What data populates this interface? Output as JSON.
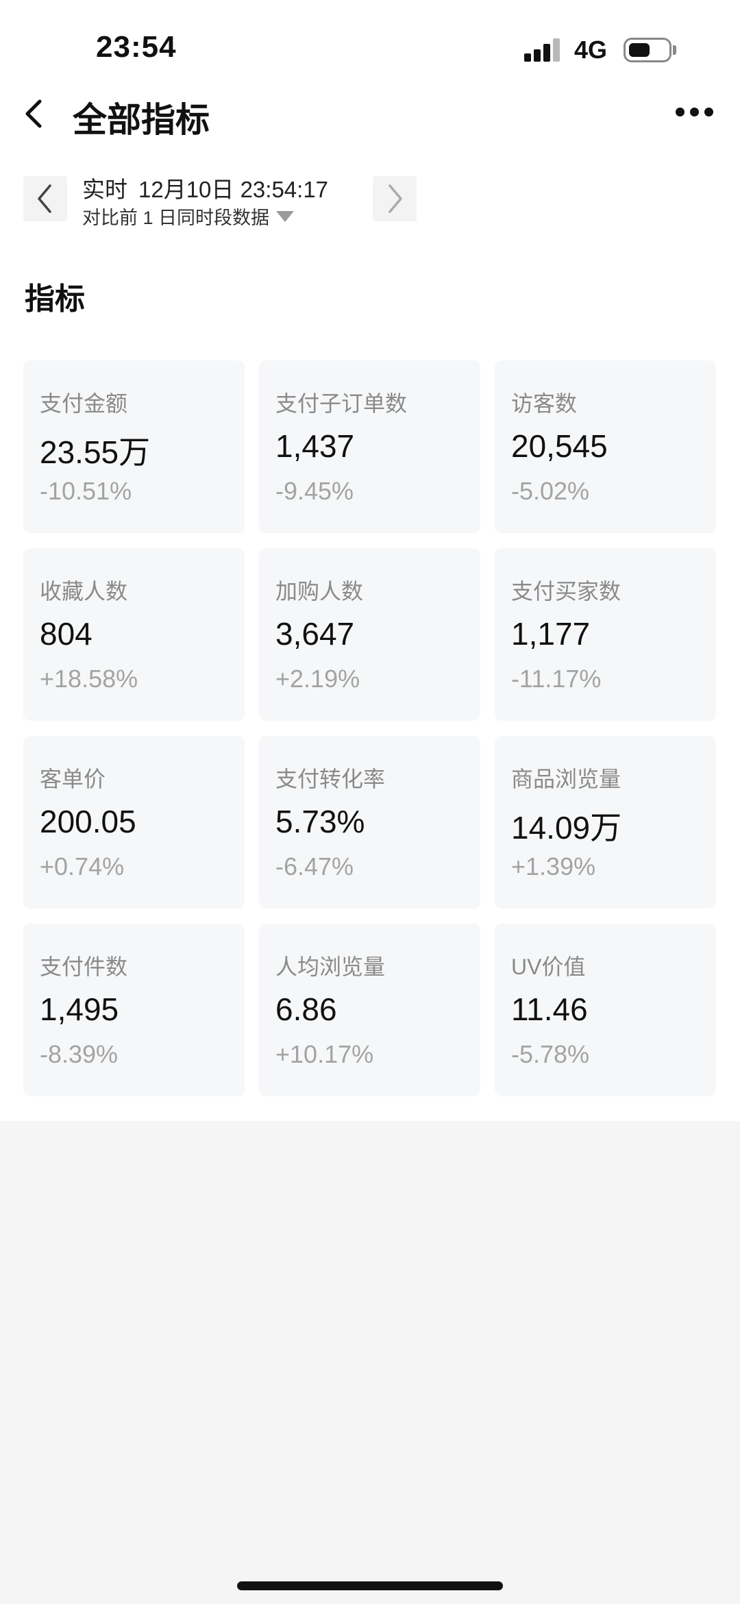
{
  "status_bar": {
    "time": "23:54",
    "network": "4G"
  },
  "header": {
    "title": "全部指标"
  },
  "date_selector": {
    "label": "实时",
    "datetime": "12月10日 23:54:17",
    "compare": "对比前 1 日同时段数据"
  },
  "section": {
    "title": "指标"
  },
  "metrics": [
    {
      "label": "支付金额",
      "value": "23.55万",
      "change": "-10.51%"
    },
    {
      "label": "支付子订单数",
      "value": "1,437",
      "change": "-9.45%"
    },
    {
      "label": "访客数",
      "value": "20,545",
      "change": "-5.02%"
    },
    {
      "label": "收藏人数",
      "value": "804",
      "change": "+18.58%"
    },
    {
      "label": "加购人数",
      "value": "3,647",
      "change": "+2.19%"
    },
    {
      "label": "支付买家数",
      "value": "1,177",
      "change": "-11.17%"
    },
    {
      "label": "客单价",
      "value": "200.05",
      "change": "+0.74%"
    },
    {
      "label": "支付转化率",
      "value": "5.73%",
      "change": "-6.47%"
    },
    {
      "label": "商品浏览量",
      "value": "14.09万",
      "change": "+1.39%"
    },
    {
      "label": "支付件数",
      "value": "1,495",
      "change": "-8.39%"
    },
    {
      "label": "人均浏览量",
      "value": "6.86",
      "change": "+10.17%"
    },
    {
      "label": "UV价值",
      "value": "11.46",
      "change": "-5.78%"
    }
  ]
}
